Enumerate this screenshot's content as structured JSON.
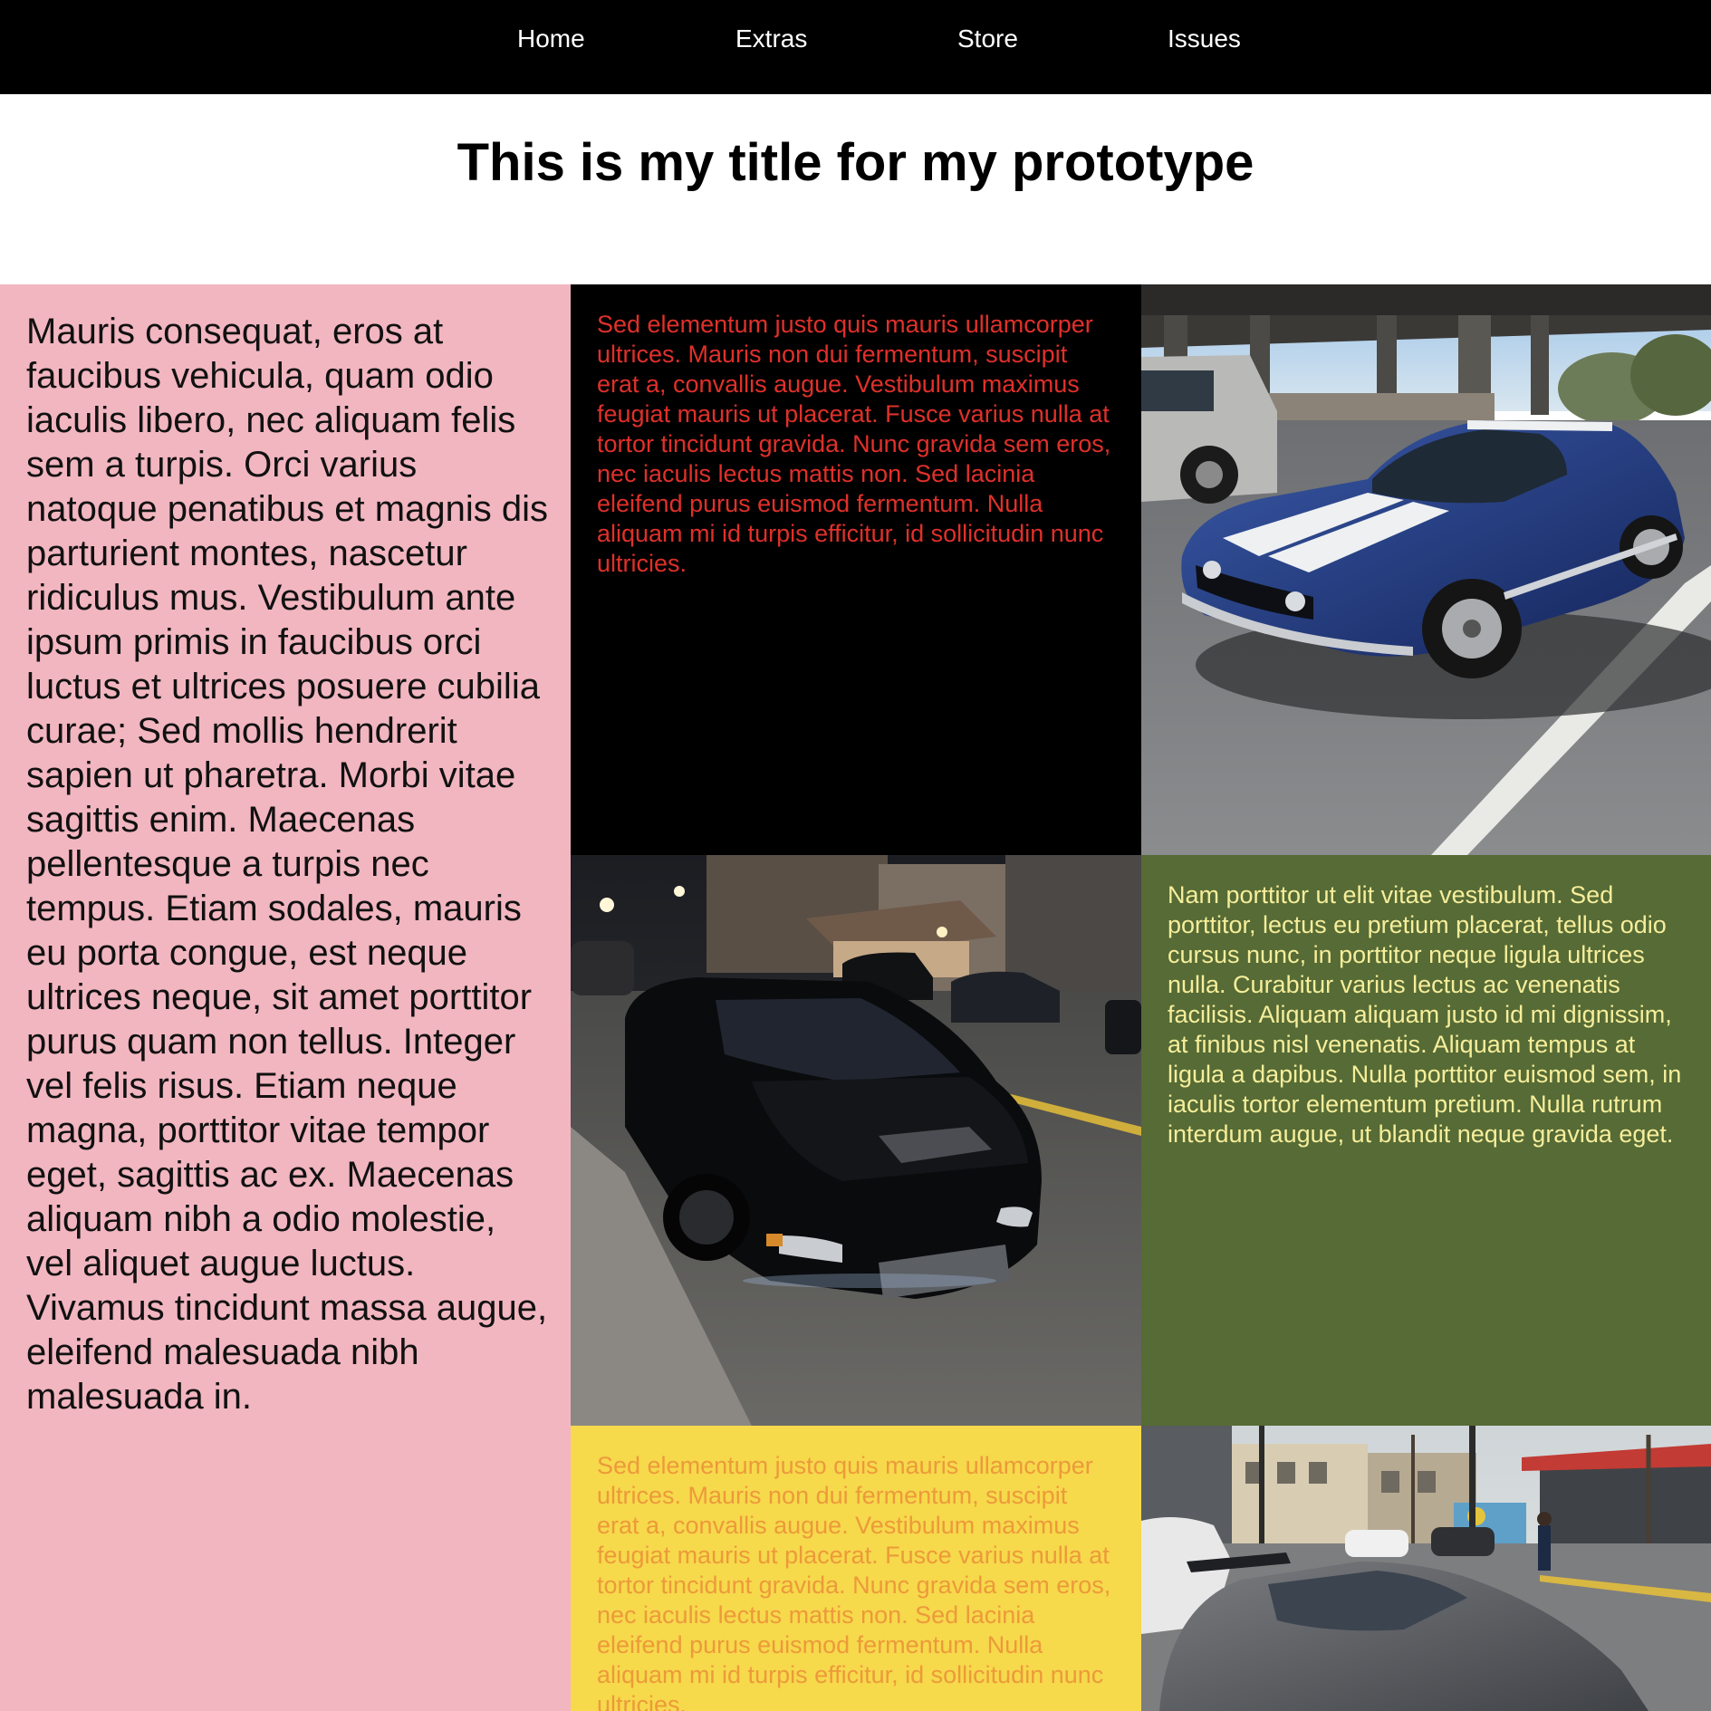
{
  "nav": {
    "items": [
      {
        "label": "Home"
      },
      {
        "label": "Extras"
      },
      {
        "label": "Store"
      },
      {
        "label": "Issues"
      }
    ]
  },
  "header": {
    "title": "This is my title for my prototype"
  },
  "panels": {
    "pink_text": "Mauris consequat, eros at faucibus vehicula, quam odio iaculis libero, nec aliquam felis sem a turpis. Orci varius natoque penatibus et magnis dis parturient montes, nascetur ridiculus mus. Vestibulum ante ipsum primis in faucibus orci luctus et ultrices posuere cubilia curae; Sed mollis hendrerit sapien ut pharetra. Morbi vitae sagittis enim. Maecenas pellentesque a turpis nec tempus. Etiam sodales, mauris eu porta congue, est neque ultrices neque, sit amet porttitor purus quam non tellus. Integer vel felis risus. Etiam neque magna, porttitor vitae tempor eget, sagittis ac ex. Maecenas aliquam nibh a odio molestie, vel aliquet augue luctus. Vivamus tincidunt massa augue, eleifend malesuada nibh malesuada in.",
    "black_text": "Sed elementum justo quis mauris ullamcorper ultrices. Mauris non dui fermentum, suscipit erat a, convallis augue. Vestibulum maximus feugiat mauris ut placerat. Fusce varius nulla at tortor tincidunt gravida. Nunc gravida sem eros, nec iaculis lectus mattis non. Sed lacinia eleifend purus euismod fermentum. Nulla aliquam mi id turpis efficitur, id sollicitudin nunc ultricies.",
    "green_text": "Nam porttitor ut elit vitae vestibulum. Sed porttitor, lectus eu pretium placerat, tellus odio cursus nunc, in porttitor neque ligula ultrices nulla. Curabitur varius lectus ac venenatis facilisis. Aliquam aliquam justo id mi dignissim, at finibus nisl venenatis. Aliquam tempus at ligula a dapibus. Nulla porttitor euismod sem, in iaculis tortor elementum pretium. Nulla rutrum interdum augue, ut blandit neque gravida eget.",
    "yellow_text": "Sed elementum justo quis mauris ullamcorper ultrices. Mauris non dui fermentum, suscipit erat a, convallis augue. Vestibulum maximus feugiat mauris ut placerat. Fusce varius nulla at tortor tincidunt gravida. Nunc gravida sem eros, nec iaculis lectus mattis non. Sed lacinia eleifend purus euismod fermentum. Nulla aliquam mi id turpis efficitur, id sollicitudin nunc ultricies."
  },
  "colors": {
    "nav_bg": "#000000",
    "nav_text": "#ffffff",
    "pink_bg": "#f2b6c0",
    "black_cell_text": "#e0302a",
    "green_bg": "#566b35",
    "green_text": "#f6ee9b",
    "yellow_bg": "#f7d94c",
    "yellow_text": "#ec9a3a"
  },
  "photos": [
    {
      "subject": "blue-muscle-car-with-white-stripes"
    },
    {
      "subject": "black-sedan-on-night-street"
    },
    {
      "subject": "gray-sports-car-on-city-street"
    }
  ]
}
